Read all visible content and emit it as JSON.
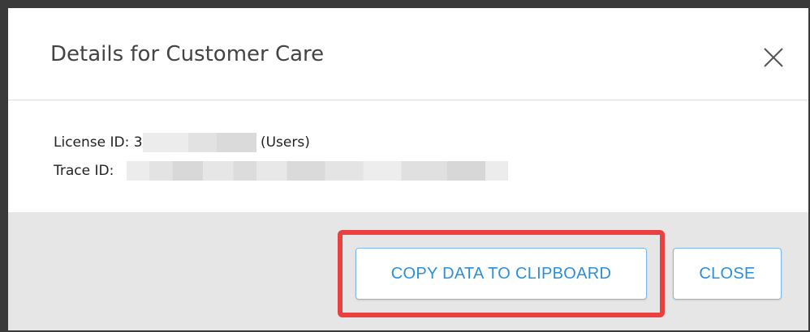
{
  "dialog": {
    "title": "Details for Customer Care",
    "close_icon": "close-icon"
  },
  "details": {
    "license_label": "License ID:",
    "license_prefix": "3",
    "license_suffix": "(Users)",
    "trace_label": "Trace ID:"
  },
  "footer": {
    "copy_button_label": "COPY DATA TO CLIPBOARD",
    "close_button_label": "CLOSE"
  },
  "colors": {
    "accent": "#2c8fd8",
    "button_border": "#7fb9e8",
    "highlight": "#e8413f",
    "footer_bg": "#e6e6e6"
  }
}
